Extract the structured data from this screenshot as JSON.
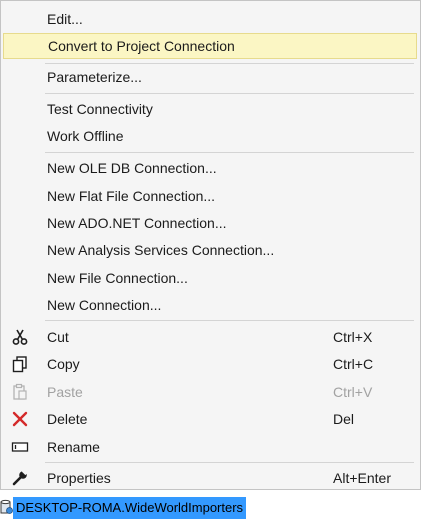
{
  "menu": {
    "edit": "Edit...",
    "convert": "Convert to Project Connection",
    "parameterize": "Parameterize...",
    "test_connectivity": "Test Connectivity",
    "work_offline": "Work Offline",
    "new_oledb": "New OLE DB Connection...",
    "new_flatfile": "New Flat File Connection...",
    "new_adonet": "New ADO.NET Connection...",
    "new_analysis": "New Analysis Services Connection...",
    "new_file": "New File Connection...",
    "new_connection": "New Connection...",
    "cut": {
      "label": "Cut",
      "shortcut": "Ctrl+X",
      "icon": "scissors-icon"
    },
    "copy": {
      "label": "Copy",
      "shortcut": "Ctrl+C",
      "icon": "copy-icon"
    },
    "paste": {
      "label": "Paste",
      "shortcut": "Ctrl+V",
      "icon": "paste-icon",
      "disabled": true
    },
    "delete": {
      "label": "Delete",
      "shortcut": "Del",
      "icon": "delete-x-icon"
    },
    "rename": {
      "label": "Rename",
      "icon": "rename-icon"
    },
    "properties": {
      "label": "Properties",
      "shortcut": "Alt+Enter",
      "icon": "wrench-icon"
    }
  },
  "tree_node": {
    "label": "DESKTOP-ROMA.WideWorldImporters"
  },
  "colors": {
    "menu_bg": "#f5f5f5",
    "highlight_bg": "#fbf6c4",
    "highlight_border": "#e7db8d",
    "selection_bg": "#3399ff",
    "delete_red": "#d42a2a",
    "disabled_text": "#a2a2a2"
  }
}
